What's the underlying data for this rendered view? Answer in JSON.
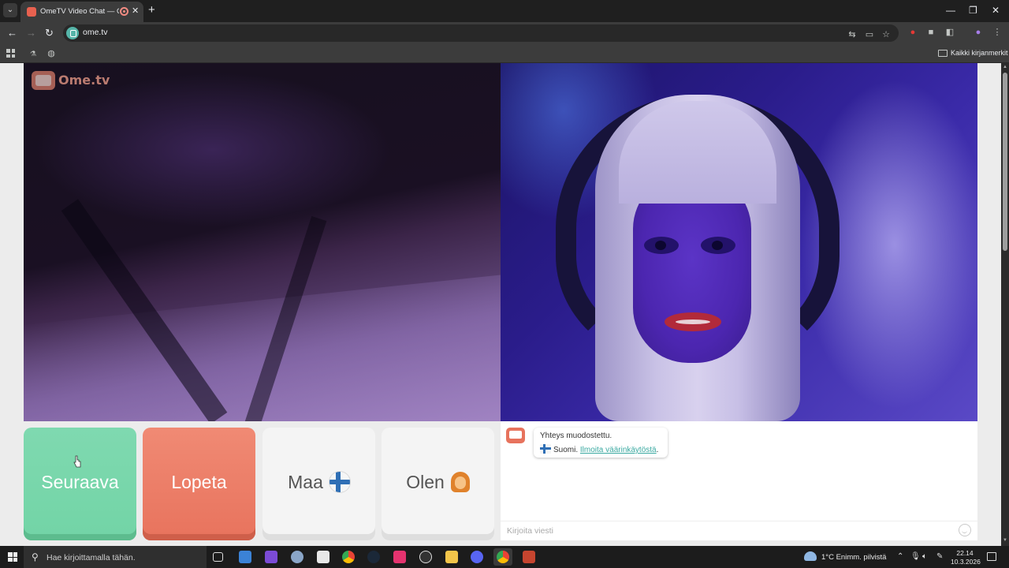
{
  "browser": {
    "tab_title": "OmeTV Video Chat — Omegle",
    "url": "ome.tv",
    "bookmarks_label": "Kaikki kirjanmerkit"
  },
  "site": {
    "logo_text": "Ome.tv"
  },
  "buttons": {
    "next_label": "Seuraava",
    "stop_label": "Lopeta",
    "country_label": "Maa",
    "gender_label": "Olen"
  },
  "chat": {
    "connection_message": "Yhteys muodostettu.",
    "country_name": "Suomi.",
    "report_link": "Ilmoita väärinkäytöstä",
    "report_suffix": ".",
    "input_placeholder": "Kirjoita viesti"
  },
  "taskbar": {
    "search_placeholder": "Hae kirjoittamalla tähän.",
    "weather_temp": "1°C",
    "weather_desc": "Enimm. pilvistä",
    "time": "22.14",
    "date": "10.3.2026"
  },
  "colors": {
    "next_button": "#72d4a6",
    "stop_button": "#e8735d",
    "link": "#3aa9a1"
  }
}
